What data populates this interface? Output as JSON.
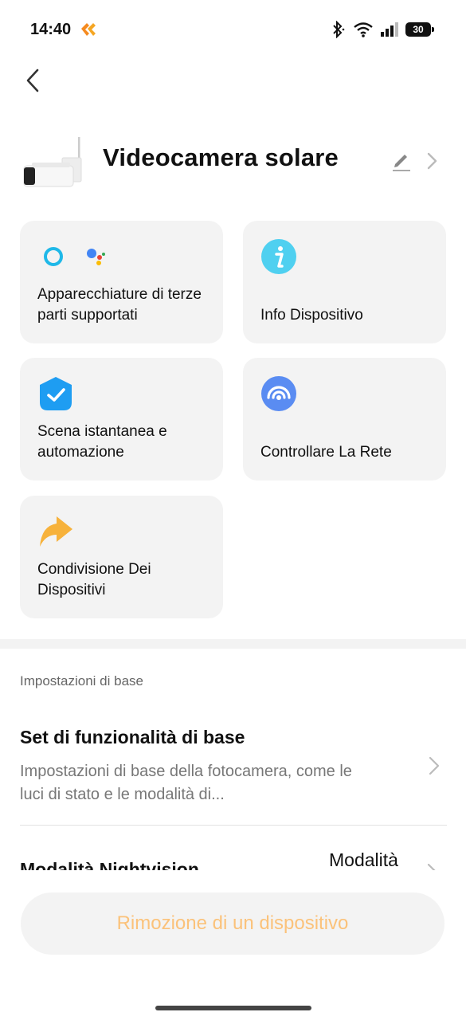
{
  "status_bar": {
    "time": "14:40",
    "battery": "30",
    "icons": [
      "notification-icon",
      "bluetooth-icon",
      "wifi-icon",
      "signal-icon",
      "battery-icon"
    ]
  },
  "nav": {
    "back_icon": "chevron-left-icon"
  },
  "device": {
    "name": "Videocamera solare",
    "edit_icon": "pencil-icon",
    "chevron_icon": "chevron-right-icon"
  },
  "cards": [
    {
      "label": "Apparecchiature di terze parti supportati",
      "icon": "alexa-google-assistant-icon"
    },
    {
      "label": "Info Dispositivo",
      "icon": "info-icon",
      "color": "#4fd0f0"
    },
    {
      "label": "Scena istantanea e automazione",
      "icon": "automation-check-icon",
      "color": "#1e9df2"
    },
    {
      "label": "Controllare La Rete",
      "icon": "network-check-icon",
      "color": "#5a8cf2"
    },
    {
      "label": "Condivisione Dei Dispositivi",
      "icon": "share-arrow-icon",
      "color": "#f7b23b"
    }
  ],
  "section": {
    "title": "Impostazioni di base",
    "items": [
      {
        "title": "Set di funzionalità di base",
        "description": "Impostazioni di base della fotocamera, come le luci di stato e le modalità di..."
      },
      {
        "title": "Modalità Nightvision",
        "value": "Modalità"
      }
    ]
  },
  "remove_button": {
    "label": "Rimozione di un dispositivo",
    "color": "#fbc27a"
  }
}
